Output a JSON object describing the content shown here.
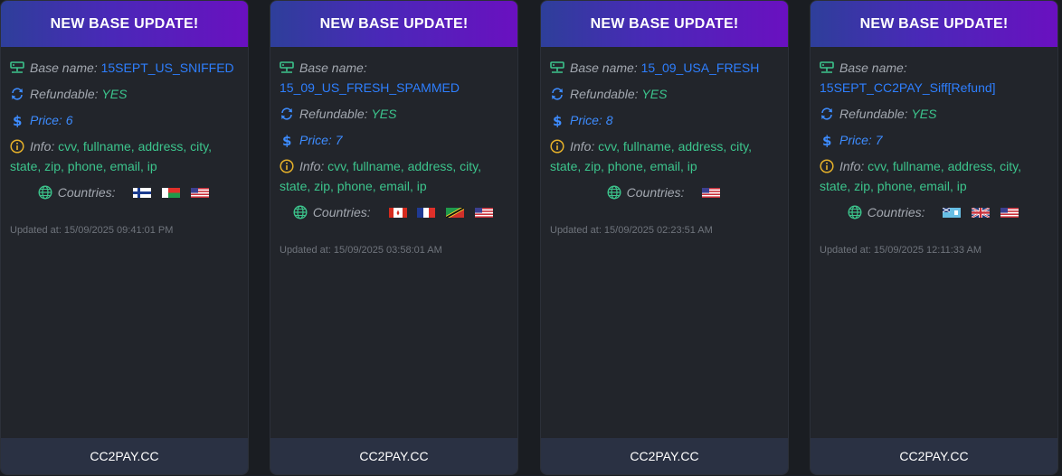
{
  "colors": {
    "header_gradient_start": "#2e3f9a",
    "header_gradient_end": "#6a10c0",
    "accent_blue": "#2e7fff",
    "accent_green": "#3cc48c",
    "info_icon": "#e6b12a"
  },
  "labels": {
    "base_name": "Base name:",
    "refundable": "Refundable:",
    "price": "Price:",
    "info": "Info:",
    "countries": "Countries:"
  },
  "cards": [
    {
      "title": "NEW BASE UPDATE!",
      "base_name": "15SEPT_US_SNIFFED",
      "refundable": "YES",
      "price": "6",
      "info": "cvv, fullname, address, city, state, zip, phone, email, ip",
      "flags": [
        "finland-flag",
        "madagascar-flag",
        "usa-flag"
      ],
      "updated": "Updated at: 15/09/2025 09:41:01 PM",
      "footer": "CC2PAY.CC"
    },
    {
      "title": "NEW BASE UPDATE!",
      "base_name": "15_09_US_FRESH_SPAMMED",
      "refundable": "YES",
      "price": "7",
      "info": "cvv, fullname, address, city, state, zip, phone, email, ip",
      "flags": [
        "canada-flag",
        "france-flag",
        "saint-kitts-flag",
        "usa-flag"
      ],
      "updated": "Updated at: 15/09/2025 03:58:01 AM",
      "footer": "CC2PAY.CC"
    },
    {
      "title": "NEW BASE UPDATE!",
      "base_name": "15_09_USA_FRESH",
      "refundable": "YES",
      "price": "8",
      "info": "cvv, fullname, address, city, state, zip, phone, email, ip",
      "flags": [
        "usa-flag"
      ],
      "updated": "Updated at: 15/09/2025 02:23:51 AM",
      "footer": "CC2PAY.CC"
    },
    {
      "title": "NEW BASE UPDATE!",
      "base_name": "15SEPT_CC2PAY_Siff[Refund]",
      "refundable": "YES",
      "price": "7",
      "info": "cvv, fullname, address, city, state, zip, phone, email, ip",
      "flags": [
        "fiji-flag",
        "uk-flag",
        "usa-flag"
      ],
      "updated": "Updated at: 15/09/2025 12:11:33 AM",
      "footer": "CC2PAY.CC"
    }
  ]
}
